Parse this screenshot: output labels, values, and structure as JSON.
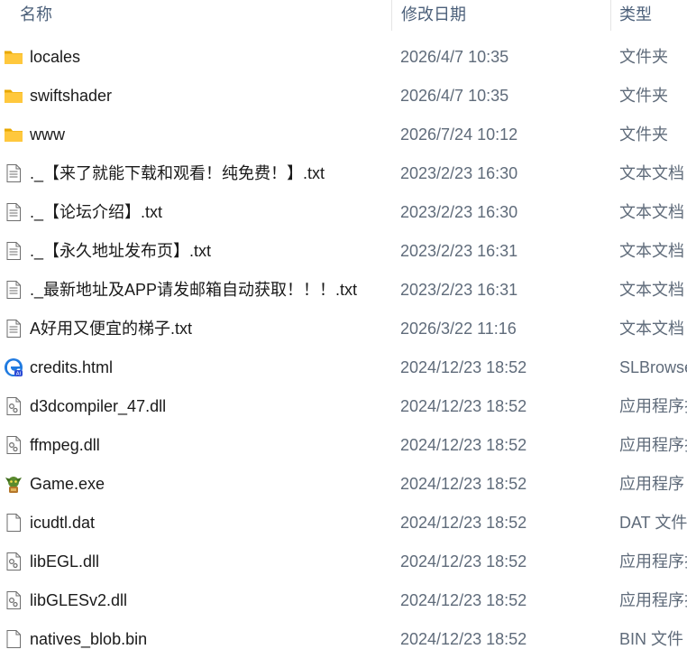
{
  "columns": {
    "name": "名称",
    "date": "修改日期",
    "type": "类型"
  },
  "files": [
    {
      "name": "locales",
      "date": "2026/4/7 10:35",
      "type": "文件夹",
      "icon": "folder-icon"
    },
    {
      "name": "swiftshader",
      "date": "2026/4/7 10:35",
      "type": "文件夹",
      "icon": "folder-icon"
    },
    {
      "name": "www",
      "date": "2026/7/24 10:12",
      "type": "文件夹",
      "icon": "folder-icon"
    },
    {
      "name": "._【来了就能下载和观看！纯免费！】.txt",
      "date": "2023/2/23 16:30",
      "type": "文本文档",
      "icon": "text-file-icon"
    },
    {
      "name": "._【论坛介绍】.txt",
      "date": "2023/2/23 16:30",
      "type": "文本文档",
      "icon": "text-file-icon"
    },
    {
      "name": "._【永久地址发布页】.txt",
      "date": "2023/2/23 16:31",
      "type": "文本文档",
      "icon": "text-file-icon"
    },
    {
      "name": "._最新地址及APP请发邮箱自动获取！！！.txt",
      "date": "2023/2/23 16:31",
      "type": "文本文档",
      "icon": "text-file-icon"
    },
    {
      "name": "A好用又便宜的梯子.txt",
      "date": "2026/3/22 11:16",
      "type": "文本文档",
      "icon": "text-file-icon"
    },
    {
      "name": "credits.html",
      "date": "2024/12/23 18:52",
      "type": "SLBrowser",
      "icon": "browser-html-icon"
    },
    {
      "name": "d3dcompiler_47.dll",
      "date": "2024/12/23 18:52",
      "type": "应用程序扩展",
      "icon": "dll-file-icon"
    },
    {
      "name": "ffmpeg.dll",
      "date": "2024/12/23 18:52",
      "type": "应用程序扩展",
      "icon": "dll-file-icon"
    },
    {
      "name": "Game.exe",
      "date": "2024/12/23 18:52",
      "type": "应用程序",
      "icon": "game-exe-icon"
    },
    {
      "name": "icudtl.dat",
      "date": "2024/12/23 18:52",
      "type": "DAT 文件",
      "icon": "blank-file-icon"
    },
    {
      "name": "libEGL.dll",
      "date": "2024/12/23 18:52",
      "type": "应用程序扩展",
      "icon": "dll-file-icon"
    },
    {
      "name": "libGLESv2.dll",
      "date": "2024/12/23 18:52",
      "type": "应用程序扩展",
      "icon": "dll-file-icon"
    },
    {
      "name": "natives_blob.bin",
      "date": "2024/12/23 18:52",
      "type": "BIN 文件",
      "icon": "blank-file-icon"
    }
  ]
}
